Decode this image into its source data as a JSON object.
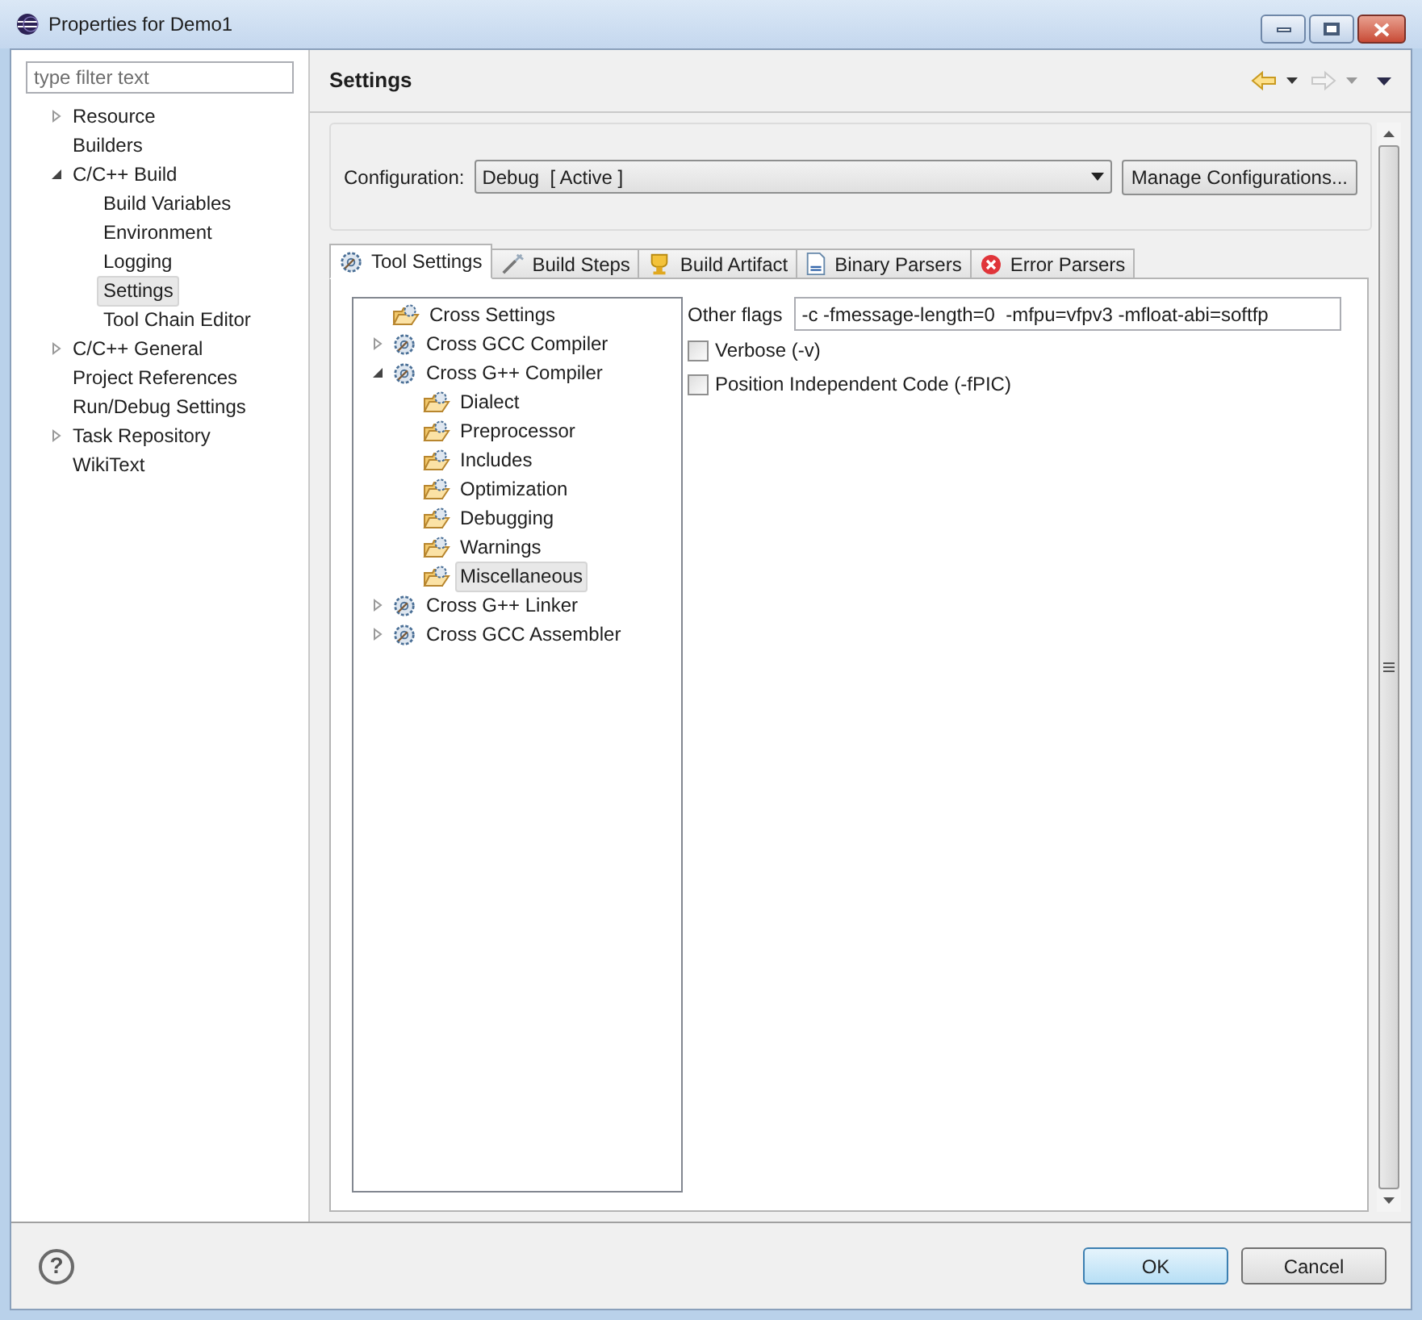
{
  "window": {
    "title": "Properties for Demo1"
  },
  "filter": {
    "placeholder": "type filter text"
  },
  "sidebar": {
    "items": [
      {
        "label": "Resource",
        "expanded": false,
        "selected": false
      },
      {
        "label": "Builders",
        "selected": false
      },
      {
        "label": "C/C++ Build",
        "expanded": true,
        "selected": false,
        "children": [
          {
            "label": "Build Variables",
            "selected": false
          },
          {
            "label": "Environment",
            "selected": false
          },
          {
            "label": "Logging",
            "selected": false
          },
          {
            "label": "Settings",
            "selected": true
          },
          {
            "label": "Tool Chain Editor",
            "selected": false
          }
        ]
      },
      {
        "label": "C/C++ General",
        "expanded": false,
        "selected": false
      },
      {
        "label": "Project References",
        "selected": false
      },
      {
        "label": "Run/Debug Settings",
        "selected": false
      },
      {
        "label": "Task Repository",
        "expanded": false,
        "selected": false
      },
      {
        "label": "WikiText",
        "selected": false
      }
    ]
  },
  "page": {
    "title": "Settings",
    "nav": [
      {
        "kind": "back",
        "disabled": false
      },
      {
        "kind": "forward",
        "disabled": true
      }
    ],
    "configuration": {
      "label": "Configuration:",
      "value": "Debug  [ Active ]",
      "button": "Manage Configurations..."
    },
    "tabs": [
      {
        "label": "Tool Settings",
        "kind": "tools",
        "selected": true
      },
      {
        "label": "Build Steps",
        "kind": "steps",
        "selected": false
      },
      {
        "label": "Build Artifact",
        "kind": "artifact",
        "selected": false
      },
      {
        "label": "Binary Parsers",
        "kind": "binary",
        "selected": false
      },
      {
        "label": "Error Parsers",
        "kind": "error",
        "selected": false
      }
    ],
    "tool_tree": [
      {
        "label": "Cross Settings",
        "kind": "category",
        "selected": false
      },
      {
        "label": "Cross GCC Compiler",
        "kind": "tool",
        "expanded": false,
        "selected": false
      },
      {
        "label": "Cross G++ Compiler",
        "kind": "tool",
        "expanded": true,
        "selected": false,
        "children": [
          {
            "label": "Dialect",
            "kind": "category",
            "selected": false
          },
          {
            "label": "Preprocessor",
            "kind": "category",
            "selected": false
          },
          {
            "label": "Includes",
            "kind": "category",
            "selected": false
          },
          {
            "label": "Optimization",
            "kind": "category",
            "selected": false
          },
          {
            "label": "Debugging",
            "kind": "category",
            "selected": false
          },
          {
            "label": "Warnings",
            "kind": "category",
            "selected": false
          },
          {
            "label": "Miscellaneous",
            "kind": "category",
            "selected": true
          }
        ]
      },
      {
        "label": "Cross G++ Linker",
        "kind": "tool",
        "expanded": false,
        "selected": false
      },
      {
        "label": "Cross GCC Assembler",
        "kind": "tool",
        "expanded": false,
        "selected": false
      }
    ],
    "options": {
      "other_flags": {
        "label": "Other flags",
        "value": "-c -fmessage-length=0  -mfpu=vfpv3 -mfloat-abi=softfp"
      },
      "checkboxes": [
        {
          "label": "Verbose (-v)",
          "checked": false
        },
        {
          "label": "Position Independent Code (-fPIC)",
          "checked": false
        }
      ]
    }
  },
  "footer": {
    "help": "?",
    "buttons": [
      {
        "label": "OK",
        "kind": "default"
      },
      {
        "label": "Cancel",
        "kind": "normal"
      }
    ]
  }
}
